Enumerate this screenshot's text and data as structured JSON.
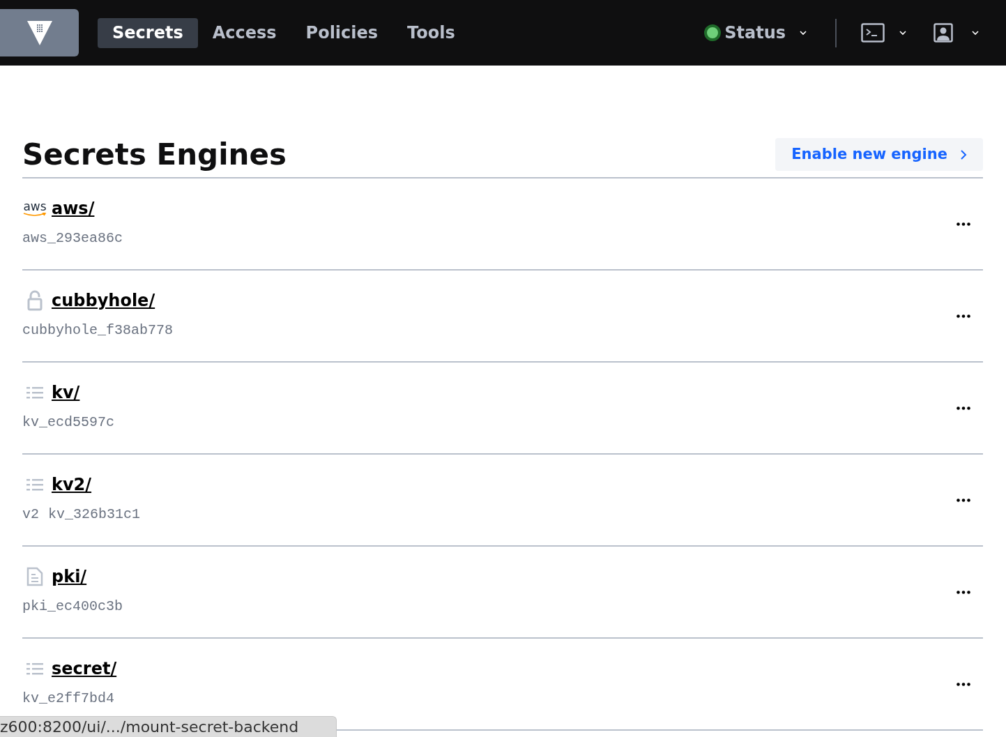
{
  "nav": {
    "tabs": [
      {
        "label": "Secrets",
        "selected": true
      },
      {
        "label": "Access",
        "selected": false
      },
      {
        "label": "Policies",
        "selected": false
      },
      {
        "label": "Tools",
        "selected": false
      }
    ],
    "status": {
      "label": "Status",
      "color": "#6fcf7a"
    }
  },
  "page": {
    "title": "Secrets Engines",
    "action": "Enable new engine"
  },
  "engines": [
    {
      "kind": "aws",
      "icon_text": "aws",
      "path": "aws/",
      "accessor": "aws_293ea86c"
    },
    {
      "kind": "lock",
      "path": "cubbyhole/",
      "accessor": "cubbyhole_f38ab778"
    },
    {
      "kind": "list",
      "path": "kv/",
      "accessor": "kv_ecd5597c"
    },
    {
      "kind": "list",
      "path": "kv2/",
      "version": "v2",
      "accessor": "kv_326b31c1"
    },
    {
      "kind": "doc",
      "path": "pki/",
      "accessor": "pki_ec400c3b"
    },
    {
      "kind": "list",
      "path": "secret/",
      "accessor": "kv_e2ff7bd4"
    }
  ],
  "status_bar": "z600:8200/ui/.../mount-secret-backend"
}
